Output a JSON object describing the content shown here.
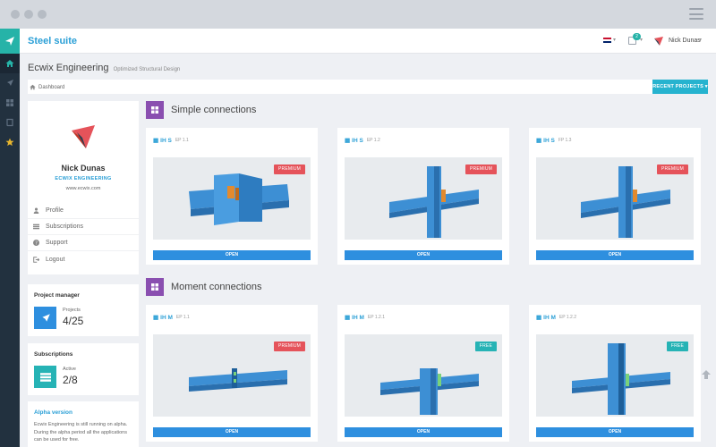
{
  "app": {
    "title": "Steel suite",
    "user_name": "Nick Dunas",
    "notification_count": "2"
  },
  "page": {
    "title": "Ecwix Engineering",
    "subtitle": "Optimized Structural Design",
    "breadcrumb": "Dashboard",
    "recent_projects_label": "RECENT PROJECTS"
  },
  "profile": {
    "name": "Nick Dunas",
    "company": "ECWIX ENGINEERING",
    "website": "www.ecwix.com",
    "menu": [
      {
        "label": "Profile",
        "icon": "user-icon"
      },
      {
        "label": "Subscriptions",
        "icon": "list-icon"
      },
      {
        "label": "Support",
        "icon": "question-icon"
      },
      {
        "label": "Logout",
        "icon": "logout-icon"
      }
    ]
  },
  "stats": {
    "projects": {
      "title": "Project manager",
      "label": "Projects",
      "value": "4/25",
      "color": "#2e8fdf"
    },
    "subscriptions": {
      "title": "Subscriptions",
      "label": "Active",
      "value": "2/8",
      "color": "#26b3b5"
    }
  },
  "alpha": {
    "title": "Alpha version",
    "text": "Ecwix Engineering is still running on alpha. During the alpha period all the applications can be used for free."
  },
  "sections": [
    {
      "title": "Simple connections",
      "cards": [
        {
          "name": "IH S",
          "code": "EP 1.1",
          "badge": "PREMIUM",
          "badge_type": "premium",
          "button": "OPEN",
          "shape": "splice-wide"
        },
        {
          "name": "IH S",
          "code": "EP 1.2",
          "badge": "PREMIUM",
          "badge_type": "premium",
          "button": "OPEN",
          "shape": "cross"
        },
        {
          "name": "IH S",
          "code": "FP 1.3",
          "badge": "PREMIUM",
          "badge_type": "premium",
          "button": "OPEN",
          "shape": "cross"
        }
      ]
    },
    {
      "title": "Moment connections",
      "cards": [
        {
          "name": "IH M",
          "code": "EP 1.1",
          "badge": "PREMIUM",
          "badge_type": "premium",
          "button": "OPEN",
          "shape": "splice"
        },
        {
          "name": "IH M",
          "code": "EP 1.2.1",
          "badge": "FREE",
          "badge_type": "free",
          "button": "OPEN",
          "shape": "tee"
        },
        {
          "name": "IH M",
          "code": "EP 1.2.2",
          "badge": "FREE",
          "badge_type": "free",
          "button": "OPEN",
          "shape": "cross-tall"
        }
      ]
    }
  ],
  "colors": {
    "accent": "#2a9fd6",
    "teal": "#26b3a8",
    "premium": "#e5535a",
    "free": "#26b3b5",
    "section_icon": "#8a4fb0",
    "rail": "#22313f"
  }
}
